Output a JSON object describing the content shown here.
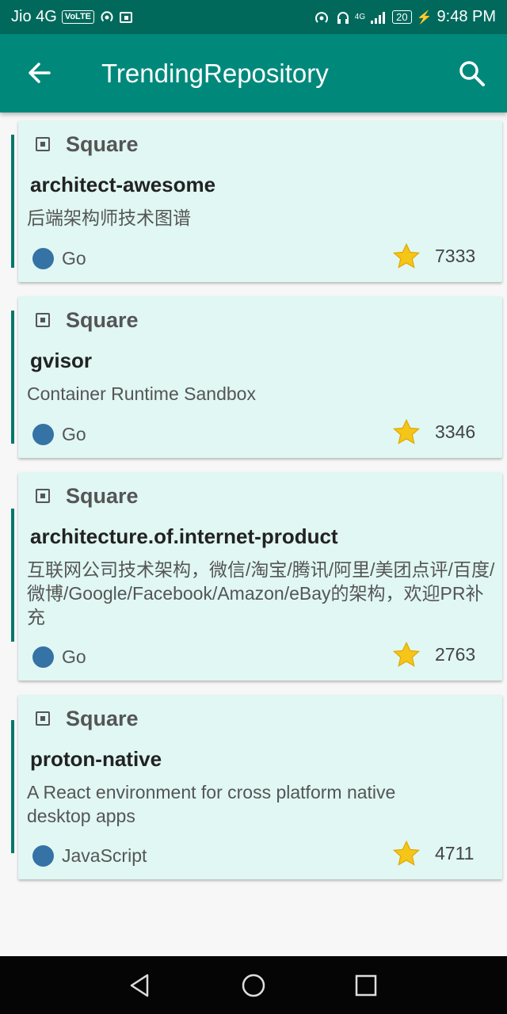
{
  "status_bar": {
    "carrier": "Jio 4G",
    "volte": "VoLTE",
    "network": "4G",
    "battery": "20",
    "time": "9:48 PM"
  },
  "app_bar": {
    "title": "TrendingRepository",
    "back_icon": "arrow-left-icon",
    "search_icon": "search-icon"
  },
  "repos": [
    {
      "owner": "Square",
      "name": "architect-awesome",
      "description": "后端架构师技术图谱",
      "language": "Go",
      "stars": "7333"
    },
    {
      "owner": "Square",
      "name": "gvisor",
      "description": "Container Runtime Sandbox",
      "language": "Go",
      "stars": "3346"
    },
    {
      "owner": "Square",
      "name": "architecture.of.internet-product",
      "description": "互联网公司技术架构，微信/淘宝/腾讯/阿里/美团点评/百度/微博/Google/Facebook/Amazon/eBay的架构，欢迎PR补充",
      "language": "Go",
      "stars": "2763"
    },
    {
      "owner": "Square",
      "name": "proton-native",
      "description": "A React environment for cross platform native desktop apps",
      "language": "JavaScript",
      "stars": "4711"
    }
  ],
  "colors": {
    "status_bar": "#00695c",
    "app_bar": "#00897b",
    "card_bg": "#e0f7f3",
    "language_dot": "#3572a5",
    "star": "#f5c518"
  },
  "nav_bar": {
    "back": "triangle-back-icon",
    "home": "circle-home-icon",
    "recents": "square-recents-icon"
  }
}
